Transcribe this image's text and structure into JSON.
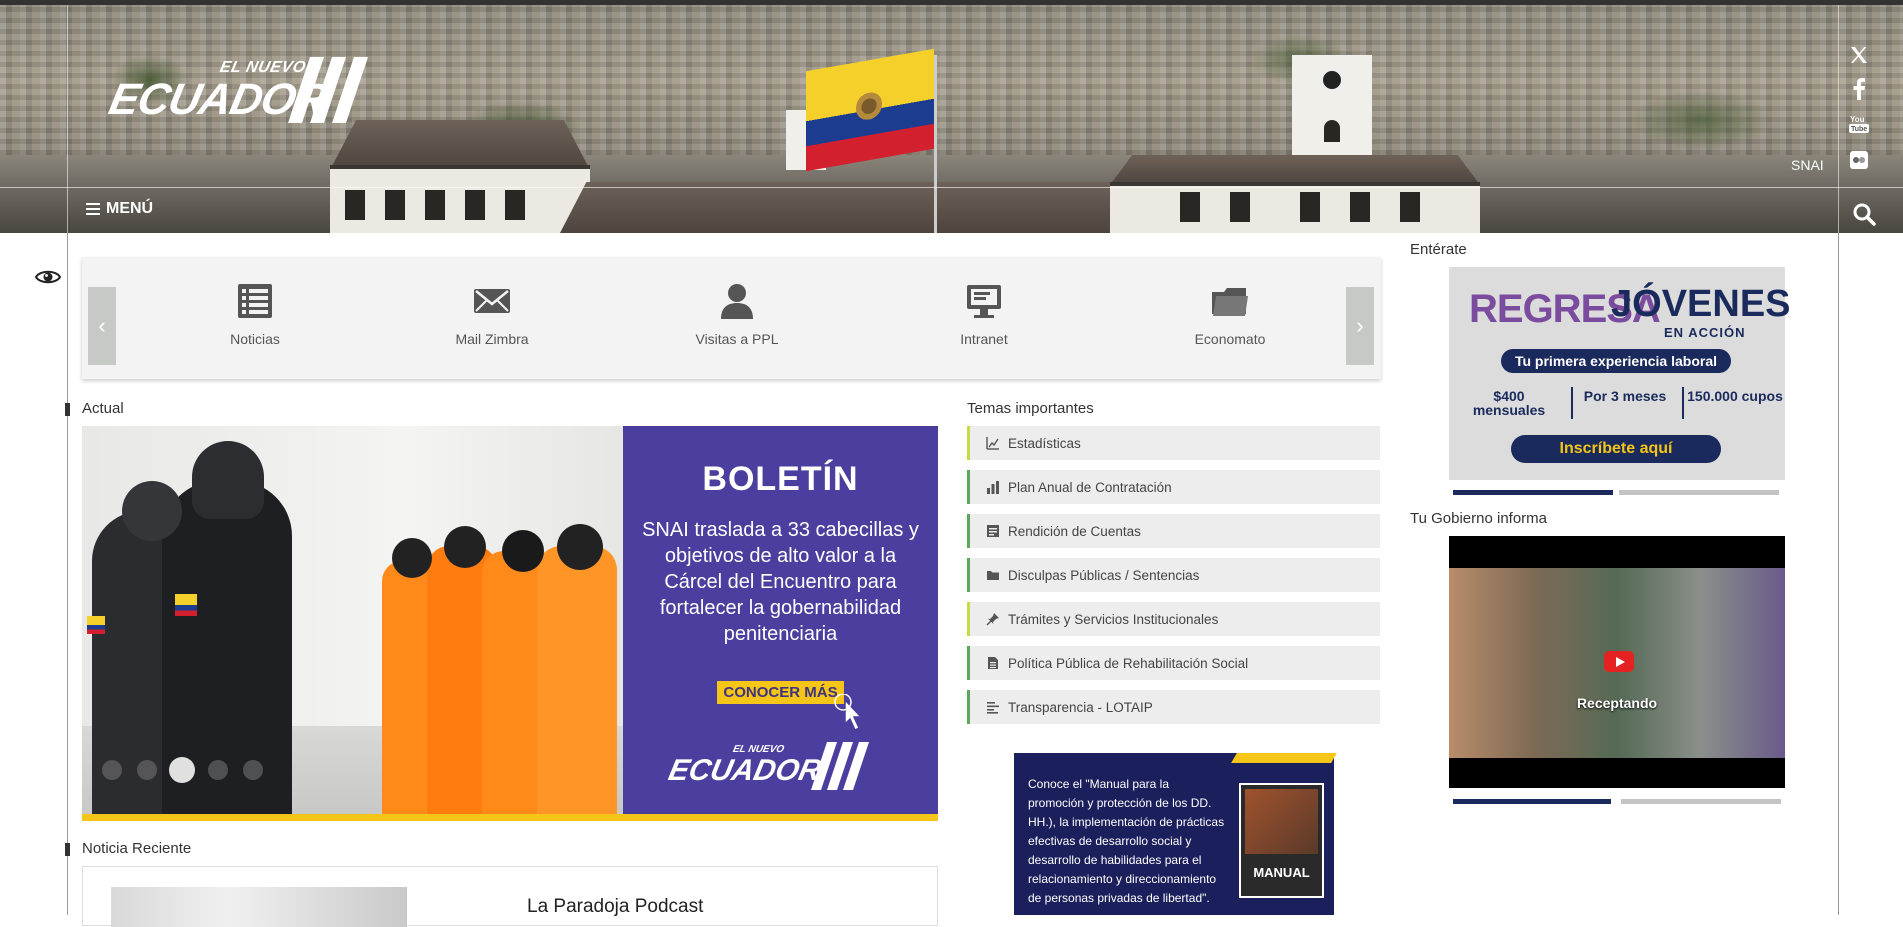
{
  "header": {
    "logo_small": "EL NUEVO",
    "logo_big": "ECUADOR",
    "menu_label": "MENÚ",
    "institution_label": "SNAI",
    "social": [
      "x-icon",
      "facebook-icon",
      "youtube-icon",
      "flickr-icon"
    ]
  },
  "quick_links": [
    {
      "label": "Noticias",
      "icon": "list-icon"
    },
    {
      "label": "Mail Zimbra",
      "icon": "mail-icon"
    },
    {
      "label": "Visitas a PPL",
      "icon": "user-icon"
    },
    {
      "label": "Intranet",
      "icon": "monitor-icon"
    },
    {
      "label": "Economato",
      "icon": "folder-icon"
    }
  ],
  "actual": {
    "heading": "Actual",
    "bulletin_title": "BOLETÍN",
    "bulletin_text": "SNAI traslada a 33 cabecillas y objetivos de alto valor a la Cárcel del Encuentro para fortalecer la gobernabilidad penitenciaria",
    "cta": "CONOCER MÁS",
    "logo_small": "EL NUEVO",
    "logo_big": "ECUADOR",
    "slides": 5,
    "active_slide": 3
  },
  "temas": {
    "heading": "Temas importantes",
    "items": [
      {
        "label": "Estadísticas",
        "icon": "chart-line-icon"
      },
      {
        "label": "Plan Anual de Contratación",
        "icon": "bar-chart-icon"
      },
      {
        "label": "Rendición de Cuentas",
        "icon": "document-icon"
      },
      {
        "label": "Disculpas Públicas / Sentencias",
        "icon": "folder-icon"
      },
      {
        "label": "Trámites y Servicios Institucionales",
        "icon": "pin-icon"
      },
      {
        "label": "Política Pública de Rehabilitación Social",
        "icon": "file-icon"
      },
      {
        "label": "Transparencia - LOTAIP",
        "icon": "align-left-icon"
      }
    ]
  },
  "manual": {
    "text": "Conoce el \"Manual para la promoción y protección de los DD. HH.), la implementación de prácticas efectivas de desarrollo social y desarrollo de habilidades para el relacionamiento y direccionamiento de personas privadas de libertad\".",
    "book_label": "MANUAL"
  },
  "noticia_reciente": {
    "heading": "Noticia Reciente",
    "title": "La Paradoja Podcast"
  },
  "enterate": {
    "heading": "Entérate",
    "regresa": "REGRESA",
    "jovenes": "JÓVENES",
    "en_accion": "EN ACCIÓN",
    "tagline": "Tu primera experiencia laboral",
    "stats": [
      "$400 mensuales",
      "Por 3 meses",
      "150.000 cupos"
    ],
    "cta": "Inscríbete aquí"
  },
  "gobierno": {
    "heading": "Tu Gobierno informa",
    "video_label": "Receptando"
  },
  "colors": {
    "accent_yellow": "#f5c518",
    "bulletin_purple": "#4a3f9e",
    "navy": "#1b2a5c",
    "tema_green": "#5aa85a",
    "tema_lime": "#c9d94a"
  }
}
